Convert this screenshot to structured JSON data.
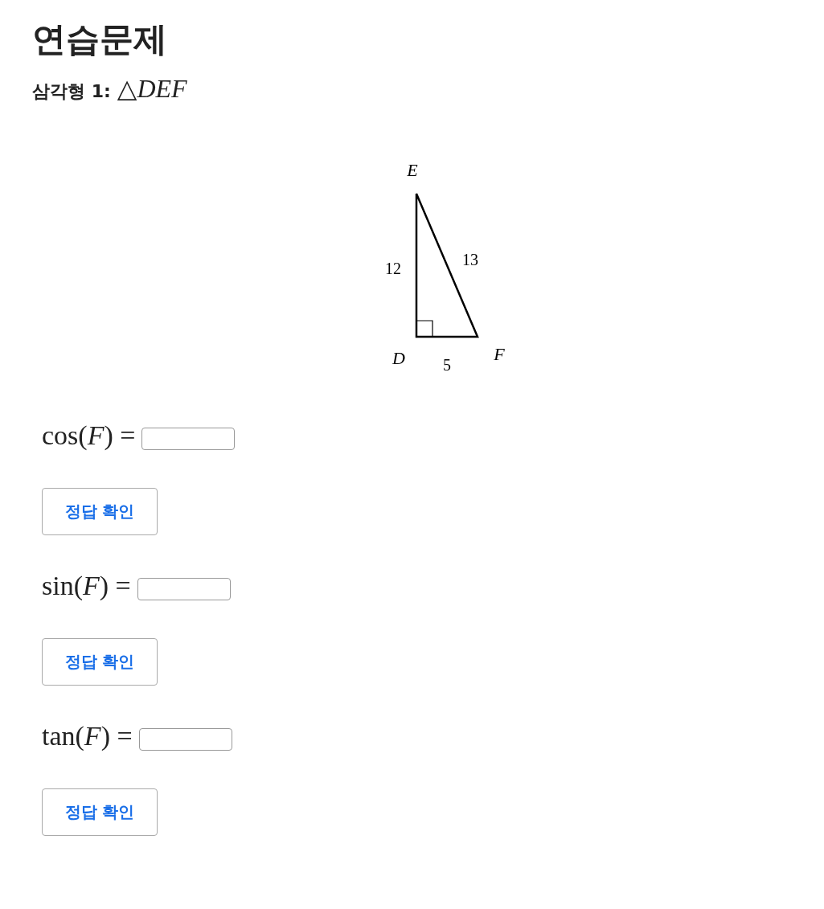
{
  "title": "연습문제",
  "subtitle": {
    "label": "삼각형 1:",
    "math": "△*DEF*"
  },
  "diagram": {
    "vertices": [
      {
        "label": "E"
      },
      {
        "label": "D"
      },
      {
        "label": "F"
      }
    ],
    "sides": [
      {
        "label": "12"
      },
      {
        "label": "13"
      },
      {
        "label": "5"
      }
    ]
  },
  "questions": [
    {
      "expression": "cos(*F*) =",
      "button": "정답 확인"
    },
    {
      "expression": "sin(*F*) =",
      "button": "정답 확인"
    },
    {
      "expression": "tan(*F*) =",
      "button": "정답 확인"
    }
  ]
}
